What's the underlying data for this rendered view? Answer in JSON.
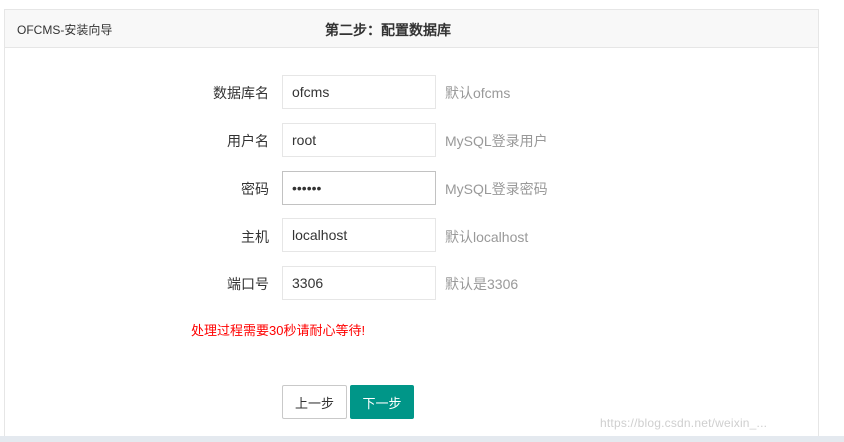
{
  "header": {
    "app_title": "OFCMS-安装向导",
    "step_title": "第二步：配置数据库"
  },
  "form": {
    "fields": [
      {
        "label": "数据库名",
        "value": "ofcms",
        "hint": "默认ofcms"
      },
      {
        "label": "用户名",
        "value": "root",
        "hint": "MySQL登录用户"
      },
      {
        "label": "密码",
        "value": "••••••",
        "hint": "MySQL登录密码"
      },
      {
        "label": "主机",
        "value": "localhost",
        "hint": "默认localhost"
      },
      {
        "label": "端口号",
        "value": "3306",
        "hint": "默认是3306"
      }
    ],
    "warning": "处理过程需要30秒请耐心等待!"
  },
  "buttons": {
    "prev_label": "上一步",
    "next_label": "下一步"
  },
  "watermark": "https://blog.csdn.net/weixin_...",
  "colors": {
    "primary": "#009688",
    "warning": "#ff0000",
    "hint": "#999999"
  }
}
